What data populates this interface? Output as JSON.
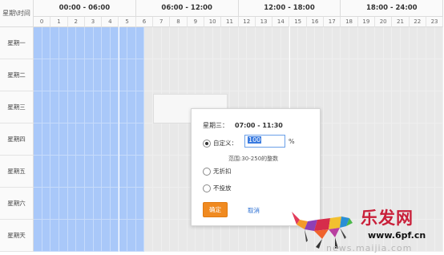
{
  "grid": {
    "corner_label": "星期\\时间",
    "periods": [
      "00:00 - 06:00",
      "06:00 - 12:00",
      "12:00 - 18:00",
      "18:00 - 24:00"
    ],
    "hours": [
      "0",
      "1",
      "2",
      "3",
      "4",
      "5",
      "6",
      "7",
      "8",
      "9",
      "10",
      "11",
      "12",
      "13",
      "14",
      "15",
      "16",
      "17",
      "18",
      "19",
      "20",
      "21",
      "22",
      "23"
    ],
    "days": [
      "星期一",
      "星期二",
      "星期三",
      "星期四",
      "星期五",
      "星期六",
      "星期天"
    ],
    "selected_hour_range": [
      0,
      6
    ],
    "colors": {
      "selected": "#a9c8f9",
      "unselected": "#e8e8e8"
    }
  },
  "popup": {
    "day": "星期三：",
    "time_range": "07:00 - 11:30",
    "option_custom_label": "自定义：",
    "custom_value": "100",
    "unit": "%",
    "hint": "范围:30-250的整数",
    "option_no_discount_label": "无折扣",
    "option_no_bid_label": "不投放",
    "selected_option": "custom",
    "confirm_label": "确定",
    "cancel_label": "取消",
    "colors": {
      "confirm": "#f08a20",
      "link": "#2b6fd3"
    }
  },
  "watermark": {
    "brand": "乐发网",
    "url": "www.6pf.cn",
    "url2": "news.maijia.com"
  }
}
